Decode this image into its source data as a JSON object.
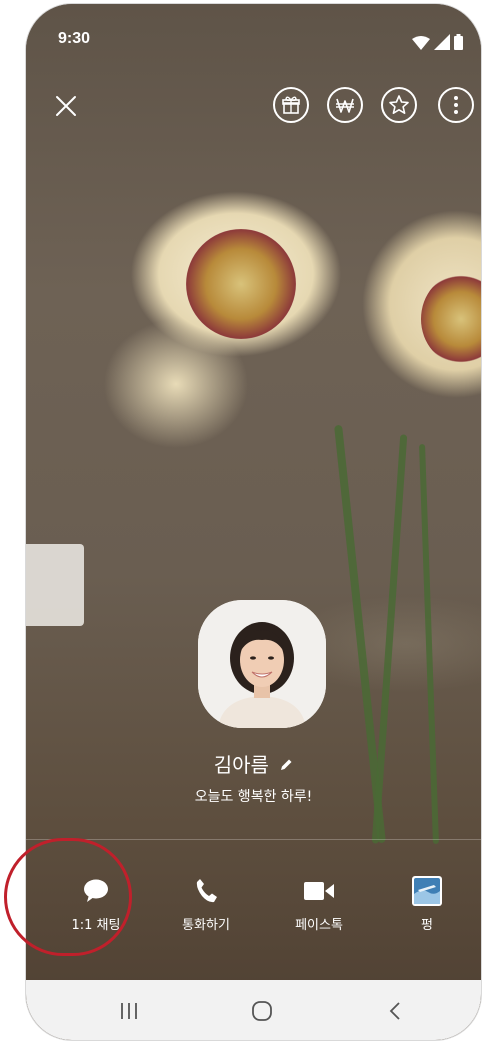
{
  "status_bar": {
    "time": "9:30"
  },
  "toolbar": {
    "close_icon": "close-icon",
    "buttons": [
      "gift-icon",
      "won-icon",
      "star-icon",
      "more-icon"
    ]
  },
  "profile": {
    "name": "김아름",
    "status_message": "오늘도 행복한 하루!"
  },
  "actions": [
    {
      "label": "1:1 채팅",
      "icon": "chat-icon"
    },
    {
      "label": "통화하기",
      "icon": "phone-icon"
    },
    {
      "label": "페이스톡",
      "icon": "video-icon"
    },
    {
      "label": "펑",
      "icon": "pung-icon"
    }
  ],
  "highlight_color": "#c0202b"
}
